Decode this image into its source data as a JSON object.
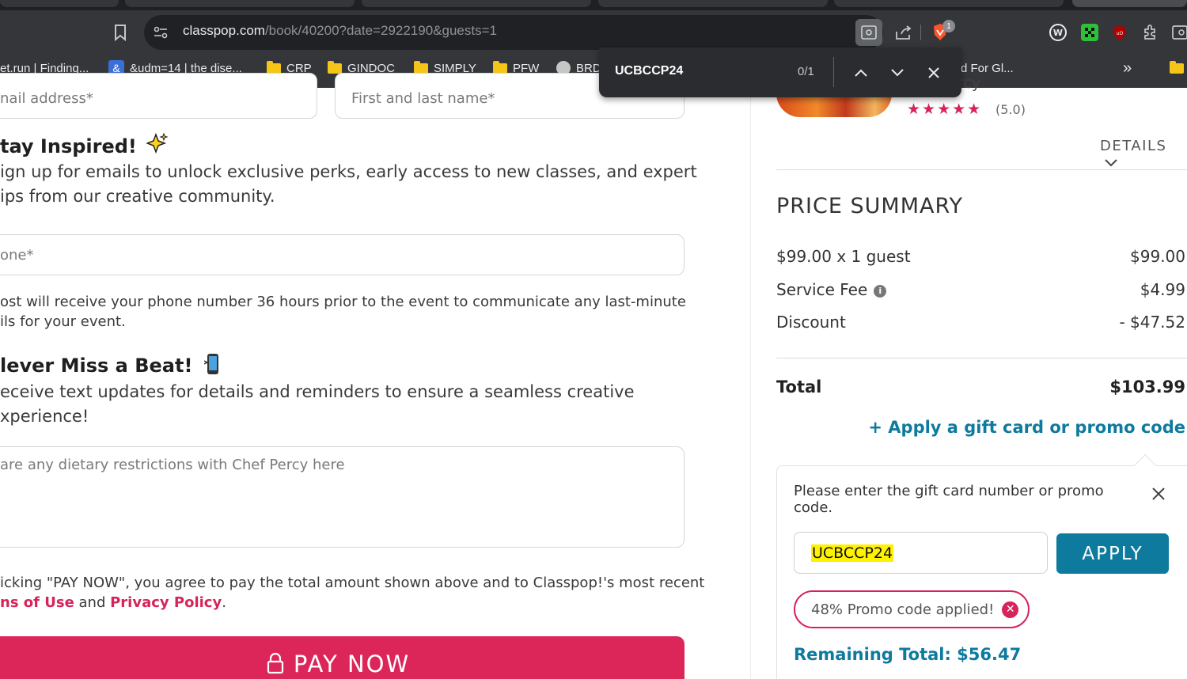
{
  "browser": {
    "url_host": "classpop.com",
    "url_path": "/book/40200?date=2922190&guests=1",
    "bookmarks": [
      "et.run | Finding...",
      "&udm=14 | the dise...",
      "CRP",
      "GINDOC",
      "SIMPLY",
      "PFW",
      "BRD",
      "d For Gl..."
    ],
    "overflow": "»",
    "find_query": "UCBCCP24",
    "find_count": "0/1",
    "badge_count": "1"
  },
  "form": {
    "email_placeholder": "nail address*",
    "name_placeholder": "First and last name*",
    "inspired_heading": "tay Inspired!",
    "inspired_text_1": "ign up for emails to unlock exclusive perks, early access to new classes, and expert",
    "inspired_text_2": "ips from our creative community.",
    "phone_placeholder": "one*",
    "phone_note_1": "ost will receive your phone number 36 hours prior to the event to communicate any last-minute",
    "phone_note_2": "ils for your event.",
    "beat_heading": "lever Miss a Beat!",
    "beat_text_1": "eceive text updates for details and reminders to ensure a seamless creative",
    "beat_text_2": "xperience!",
    "dietary_placeholder": "are any dietary restrictions with Chef Percy here",
    "terms_1": "icking \"PAY NOW\", you agree to pay the total amount shown above and to Classpop!'s most recent",
    "terms_link_1": "ns of Use",
    "terms_and": " and ",
    "terms_link_2": "Privacy Policy",
    "terms_end": ".",
    "pay_label": "PAY NOW"
  },
  "summary": {
    "title_fragment": "rcy",
    "rating": "(5.0)",
    "stars": "★★★★★",
    "details_label": "DETAILS",
    "price_summary_title": "PRICE SUMMARY",
    "line_items": [
      {
        "label": "$99.00 x 1 guest",
        "value": "$99.00"
      },
      {
        "label": "Service Fee",
        "value": "$4.99"
      },
      {
        "label": "Discount",
        "value": "- $47.52"
      }
    ],
    "total_label": "Total",
    "total_value": "$103.99",
    "promo_link": "+ Apply a gift card or promo code",
    "panel_message_1": "Please enter the gift card number or promo",
    "panel_message_2": "code.",
    "code_value": "UCBCCP24",
    "apply_label": "APPLY",
    "applied_text": "48% Promo code applied!",
    "remaining_total": "Remaining Total: $56.47"
  },
  "colors": {
    "brand_pink": "#d6245a",
    "brand_teal": "#0e7a9e",
    "highlight": "#fff200"
  }
}
